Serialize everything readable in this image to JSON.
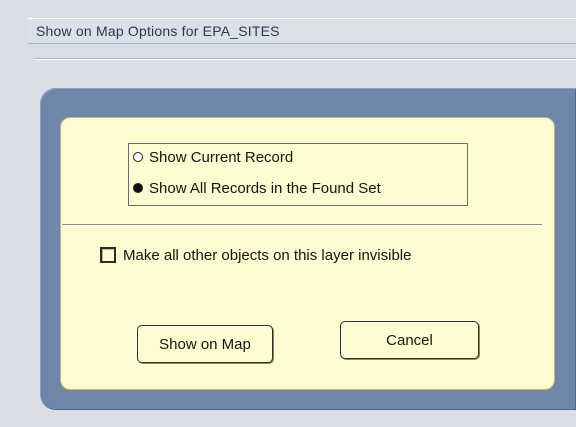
{
  "header": {
    "title": "Show on Map Options for EPA_SITES"
  },
  "dialog": {
    "radio_options": [
      {
        "label": "Show Current Record",
        "selected": false
      },
      {
        "label": "Show All Records in the Found Set",
        "selected": true
      }
    ],
    "checkbox": {
      "label": "Make all other objects on this layer invisible",
      "checked": false
    },
    "buttons": {
      "show_on_map": "Show on Map",
      "cancel": "Cancel"
    }
  },
  "colors": {
    "page_background": "#d8dde6",
    "outer_panel": "#6f86a8",
    "dialog_background": "#fdfbcf"
  }
}
